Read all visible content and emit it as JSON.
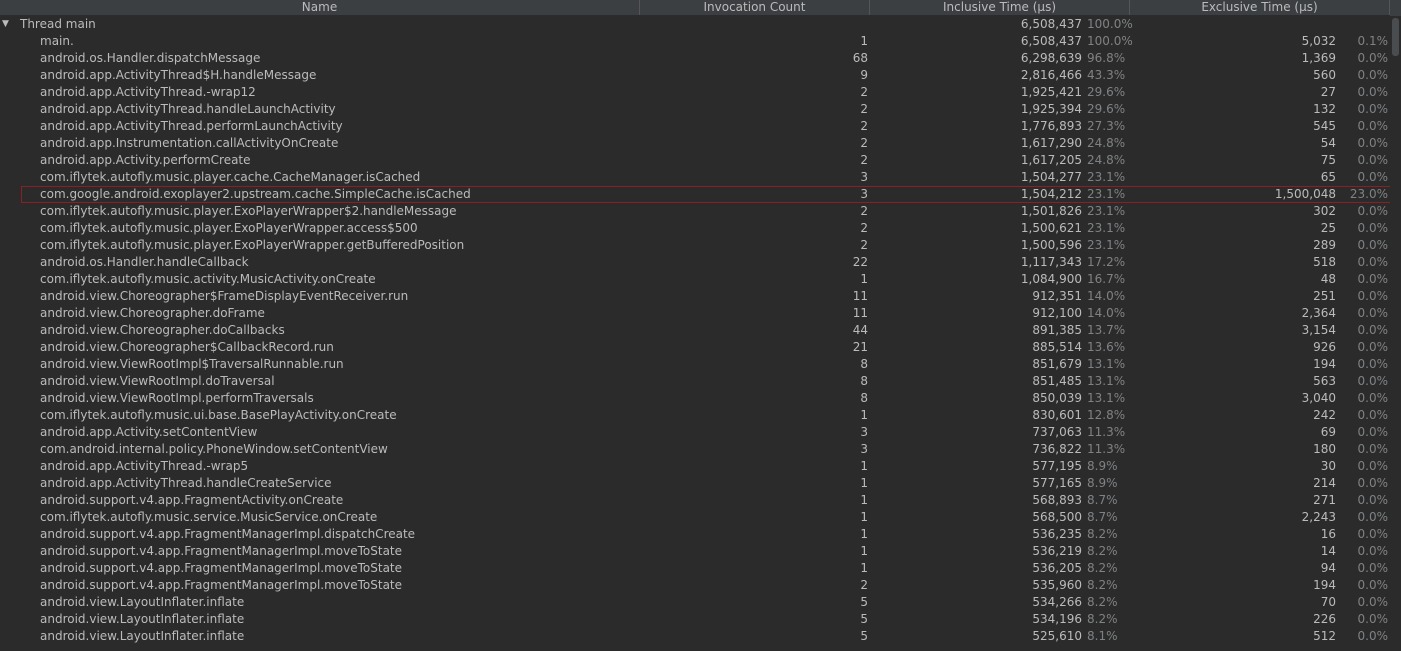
{
  "columns": {
    "name": "Name",
    "invocation_count": "Invocation Count",
    "inclusive_time": "Inclusive Time (µs)",
    "exclusive_time": "Exclusive Time (µs)"
  },
  "root": {
    "toggle_glyph": "▼",
    "name": "Thread main",
    "inclusive": "6,508,437",
    "inclusive_pct": "100.0%"
  },
  "rows": [
    {
      "name": "main.",
      "count": "1",
      "inclusive": "6,508,437",
      "inclusive_pct": "100.0%",
      "exclusive": "5,032",
      "exclusive_pct": "0.1%"
    },
    {
      "name": "android.os.Handler.dispatchMessage",
      "count": "68",
      "inclusive": "6,298,639",
      "inclusive_pct": "96.8%",
      "exclusive": "1,369",
      "exclusive_pct": "0.0%"
    },
    {
      "name": "android.app.ActivityThread$H.handleMessage",
      "count": "9",
      "inclusive": "2,816,466",
      "inclusive_pct": "43.3%",
      "exclusive": "560",
      "exclusive_pct": "0.0%"
    },
    {
      "name": "android.app.ActivityThread.-wrap12",
      "count": "2",
      "inclusive": "1,925,421",
      "inclusive_pct": "29.6%",
      "exclusive": "27",
      "exclusive_pct": "0.0%"
    },
    {
      "name": "android.app.ActivityThread.handleLaunchActivity",
      "count": "2",
      "inclusive": "1,925,394",
      "inclusive_pct": "29.6%",
      "exclusive": "132",
      "exclusive_pct": "0.0%"
    },
    {
      "name": "android.app.ActivityThread.performLaunchActivity",
      "count": "2",
      "inclusive": "1,776,893",
      "inclusive_pct": "27.3%",
      "exclusive": "545",
      "exclusive_pct": "0.0%"
    },
    {
      "name": "android.app.Instrumentation.callActivityOnCreate",
      "count": "2",
      "inclusive": "1,617,290",
      "inclusive_pct": "24.8%",
      "exclusive": "54",
      "exclusive_pct": "0.0%"
    },
    {
      "name": "android.app.Activity.performCreate",
      "count": "2",
      "inclusive": "1,617,205",
      "inclusive_pct": "24.8%",
      "exclusive": "75",
      "exclusive_pct": "0.0%"
    },
    {
      "name": "com.iflytek.autofly.music.player.cache.CacheManager.isCached",
      "count": "3",
      "inclusive": "1,504,277",
      "inclusive_pct": "23.1%",
      "exclusive": "65",
      "exclusive_pct": "0.0%"
    },
    {
      "name": "com.google.android.exoplayer2.upstream.cache.SimpleCache.isCached",
      "count": "3",
      "inclusive": "1,504,212",
      "inclusive_pct": "23.1%",
      "exclusive": "1,500,048",
      "exclusive_pct": "23.0%",
      "selected": true
    },
    {
      "name": "com.iflytek.autofly.music.player.ExoPlayerWrapper$2.handleMessage",
      "count": "2",
      "inclusive": "1,501,826",
      "inclusive_pct": "23.1%",
      "exclusive": "302",
      "exclusive_pct": "0.0%"
    },
    {
      "name": "com.iflytek.autofly.music.player.ExoPlayerWrapper.access$500",
      "count": "2",
      "inclusive": "1,500,621",
      "inclusive_pct": "23.1%",
      "exclusive": "25",
      "exclusive_pct": "0.0%"
    },
    {
      "name": "com.iflytek.autofly.music.player.ExoPlayerWrapper.getBufferedPosition",
      "count": "2",
      "inclusive": "1,500,596",
      "inclusive_pct": "23.1%",
      "exclusive": "289",
      "exclusive_pct": "0.0%"
    },
    {
      "name": "android.os.Handler.handleCallback",
      "count": "22",
      "inclusive": "1,117,343",
      "inclusive_pct": "17.2%",
      "exclusive": "518",
      "exclusive_pct": "0.0%"
    },
    {
      "name": "com.iflytek.autofly.music.activity.MusicActivity.onCreate",
      "count": "1",
      "inclusive": "1,084,900",
      "inclusive_pct": "16.7%",
      "exclusive": "48",
      "exclusive_pct": "0.0%"
    },
    {
      "name": "android.view.Choreographer$FrameDisplayEventReceiver.run",
      "count": "11",
      "inclusive": "912,351",
      "inclusive_pct": "14.0%",
      "exclusive": "251",
      "exclusive_pct": "0.0%"
    },
    {
      "name": "android.view.Choreographer.doFrame",
      "count": "11",
      "inclusive": "912,100",
      "inclusive_pct": "14.0%",
      "exclusive": "2,364",
      "exclusive_pct": "0.0%"
    },
    {
      "name": "android.view.Choreographer.doCallbacks",
      "count": "44",
      "inclusive": "891,385",
      "inclusive_pct": "13.7%",
      "exclusive": "3,154",
      "exclusive_pct": "0.0%"
    },
    {
      "name": "android.view.Choreographer$CallbackRecord.run",
      "count": "21",
      "inclusive": "885,514",
      "inclusive_pct": "13.6%",
      "exclusive": "926",
      "exclusive_pct": "0.0%"
    },
    {
      "name": "android.view.ViewRootImpl$TraversalRunnable.run",
      "count": "8",
      "inclusive": "851,679",
      "inclusive_pct": "13.1%",
      "exclusive": "194",
      "exclusive_pct": "0.0%"
    },
    {
      "name": "android.view.ViewRootImpl.doTraversal",
      "count": "8",
      "inclusive": "851,485",
      "inclusive_pct": "13.1%",
      "exclusive": "563",
      "exclusive_pct": "0.0%"
    },
    {
      "name": "android.view.ViewRootImpl.performTraversals",
      "count": "8",
      "inclusive": "850,039",
      "inclusive_pct": "13.1%",
      "exclusive": "3,040",
      "exclusive_pct": "0.0%"
    },
    {
      "name": "com.iflytek.autofly.music.ui.base.BasePlayActivity.onCreate",
      "count": "1",
      "inclusive": "830,601",
      "inclusive_pct": "12.8%",
      "exclusive": "242",
      "exclusive_pct": "0.0%"
    },
    {
      "name": "android.app.Activity.setContentView",
      "count": "3",
      "inclusive": "737,063",
      "inclusive_pct": "11.3%",
      "exclusive": "69",
      "exclusive_pct": "0.0%"
    },
    {
      "name": "com.android.internal.policy.PhoneWindow.setContentView",
      "count": "3",
      "inclusive": "736,822",
      "inclusive_pct": "11.3%",
      "exclusive": "180",
      "exclusive_pct": "0.0%"
    },
    {
      "name": "android.app.ActivityThread.-wrap5",
      "count": "1",
      "inclusive": "577,195",
      "inclusive_pct": "8.9%",
      "exclusive": "30",
      "exclusive_pct": "0.0%"
    },
    {
      "name": "android.app.ActivityThread.handleCreateService",
      "count": "1",
      "inclusive": "577,165",
      "inclusive_pct": "8.9%",
      "exclusive": "214",
      "exclusive_pct": "0.0%"
    },
    {
      "name": "android.support.v4.app.FragmentActivity.onCreate",
      "count": "1",
      "inclusive": "568,893",
      "inclusive_pct": "8.7%",
      "exclusive": "271",
      "exclusive_pct": "0.0%"
    },
    {
      "name": "com.iflytek.autofly.music.service.MusicService.onCreate",
      "count": "1",
      "inclusive": "568,500",
      "inclusive_pct": "8.7%",
      "exclusive": "2,243",
      "exclusive_pct": "0.0%"
    },
    {
      "name": "android.support.v4.app.FragmentManagerImpl.dispatchCreate",
      "count": "1",
      "inclusive": "536,235",
      "inclusive_pct": "8.2%",
      "exclusive": "16",
      "exclusive_pct": "0.0%"
    },
    {
      "name": "android.support.v4.app.FragmentManagerImpl.moveToState",
      "count": "1",
      "inclusive": "536,219",
      "inclusive_pct": "8.2%",
      "exclusive": "14",
      "exclusive_pct": "0.0%"
    },
    {
      "name": "android.support.v4.app.FragmentManagerImpl.moveToState",
      "count": "1",
      "inclusive": "536,205",
      "inclusive_pct": "8.2%",
      "exclusive": "94",
      "exclusive_pct": "0.0%"
    },
    {
      "name": "android.support.v4.app.FragmentManagerImpl.moveToState",
      "count": "2",
      "inclusive": "535,960",
      "inclusive_pct": "8.2%",
      "exclusive": "194",
      "exclusive_pct": "0.0%"
    },
    {
      "name": "android.view.LayoutInflater.inflate",
      "count": "5",
      "inclusive": "534,266",
      "inclusive_pct": "8.2%",
      "exclusive": "70",
      "exclusive_pct": "0.0%"
    },
    {
      "name": "android.view.LayoutInflater.inflate",
      "count": "5",
      "inclusive": "534,196",
      "inclusive_pct": "8.2%",
      "exclusive": "226",
      "exclusive_pct": "0.0%"
    },
    {
      "name": "android.view.LayoutInflater.inflate",
      "count": "5",
      "inclusive": "525,610",
      "inclusive_pct": "8.1%",
      "exclusive": "512",
      "exclusive_pct": "0.0%"
    }
  ],
  "colors": {
    "background": "#2b2b2b",
    "header": "#3c3f41",
    "text": "#bbbbbb",
    "percent_text": "#7f8285",
    "selection_border": "#8a1f24"
  }
}
